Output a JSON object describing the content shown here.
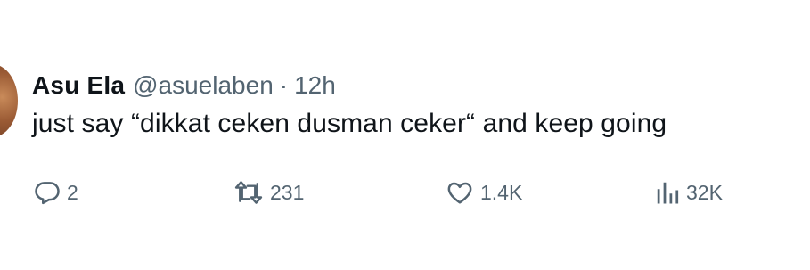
{
  "tweet": {
    "display_name": "Asu Ela",
    "handle": "@asuelaben",
    "separator": "·",
    "time": "12h",
    "text": "just say “dikkat ceken dusman ceker“ and keep going",
    "actions": {
      "reply": {
        "icon": "reply-icon",
        "count": "2"
      },
      "retweet": {
        "icon": "retweet-icon",
        "count": "231"
      },
      "like": {
        "icon": "heart-icon",
        "count": "1.4K"
      },
      "views": {
        "icon": "views-icon",
        "count": "32K"
      }
    }
  },
  "colors": {
    "text_primary": "#0f1419",
    "text_secondary": "#536471",
    "background": "#ffffff"
  }
}
